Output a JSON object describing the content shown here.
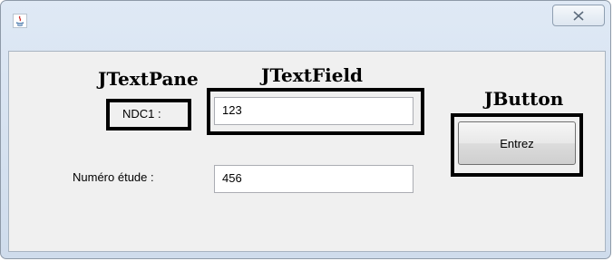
{
  "window": {
    "close_icon": "close-icon",
    "app_icon": "java-icon"
  },
  "annotations": {
    "jtextpane": "JTextPane",
    "jtextfield": "JTextField",
    "jbutton": "JButton"
  },
  "form": {
    "ndc_label": "NDC1 :",
    "ndc_value": "123",
    "etude_label": "Numéro étude :",
    "etude_value": "456",
    "submit_label": "Entrez"
  },
  "colors": {
    "window_frame": "#cfdcec",
    "client_bg": "#f0f0f0",
    "highlight_border": "#000000"
  }
}
